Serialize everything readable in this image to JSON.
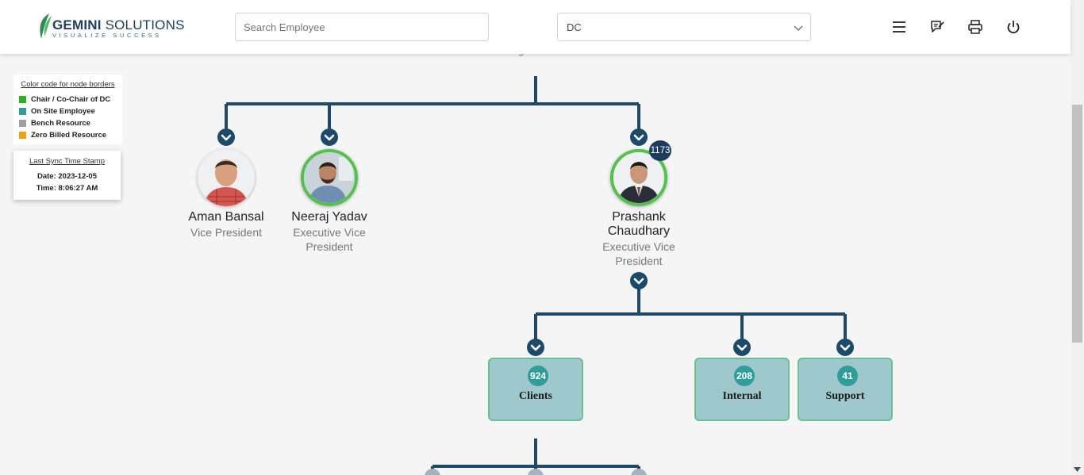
{
  "header": {
    "logo_brand_bold": "GEMINI",
    "logo_brand_rest": " SOLUTIONS",
    "logo_tagline": "VISUALIZE SUCCESS",
    "search_placeholder": "Search Employee",
    "filter_value": "DC",
    "icons": [
      "menu-icon",
      "feedback-icon",
      "print-icon",
      "power-icon"
    ]
  },
  "legend": {
    "title": "Color code for node borders",
    "items": [
      {
        "label": "Chair / Co-Chair of DC",
        "color": "#2bb31d"
      },
      {
        "label": "On Site Employee",
        "color": "#2f9e9b"
      },
      {
        "label": "Bench Resource",
        "color": "#a0a0a0"
      },
      {
        "label": "Zero Billed Resource",
        "color": "#f0a014"
      }
    ]
  },
  "sync": {
    "title": "Last Sync Time Stamp",
    "date": "Date: 2023-12-05",
    "time": "Time: 8:06:27 AM"
  },
  "tree": {
    "people": [
      {
        "name": "Aman Bansal",
        "role": "Vice President",
        "highlight": false
      },
      {
        "name": "Neeraj Yadav",
        "role": "Executive Vice President",
        "highlight": true
      },
      {
        "name": "Prashank Chaudhary",
        "role": "Executive Vice President",
        "highlight": true,
        "count": "1173"
      }
    ],
    "departments": [
      {
        "label": "Clients",
        "count": "924"
      },
      {
        "label": "Internal",
        "count": "208"
      },
      {
        "label": "Support",
        "count": "41"
      }
    ]
  },
  "colors": {
    "connector": "#1e4a6a",
    "dept_fill": "#9fc8cc",
    "dept_border": "#6cc08d",
    "dept_badge": "#2f9e9b",
    "count_badge": "#1e3d5c",
    "chair_border": "#53c24a"
  }
}
